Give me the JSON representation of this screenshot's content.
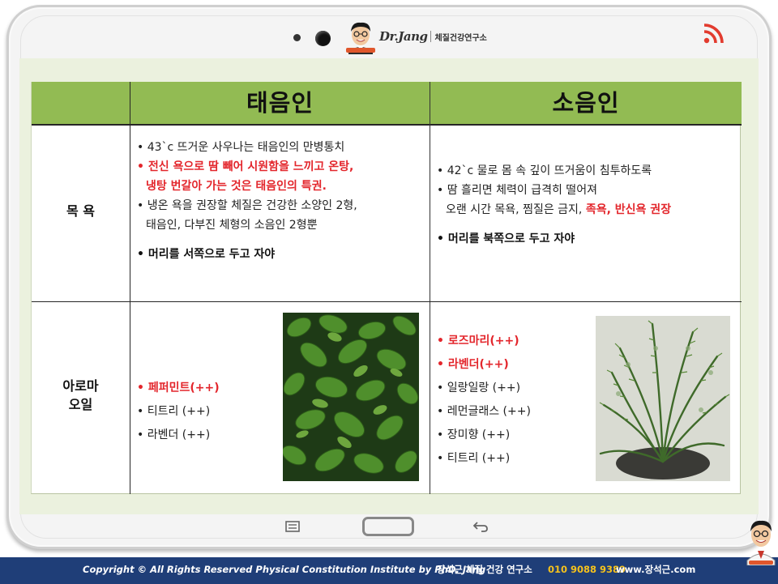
{
  "header": {
    "logo_brand": "Dr.Jang",
    "logo_tagline": "체질건강연구소"
  },
  "table": {
    "columns": [
      "태음인",
      "소음인"
    ],
    "rows": {
      "bath": {
        "label": "목  욕",
        "taeeum": [
          "• 43`c 뜨거운 사우나는 태음인의 만병통치",
          "• 전신 욕으로 땀 빼어 시원함을 느끼고 온탕,",
          "냉탕 번갈아 가는 것은 태음인의 특권.",
          "• 냉온 욕을 권장할 체질은 건강한 소양인 2형,",
          "태음인, 다부진 체형의 소음인 2형뿐",
          "• 머리를 서쪽으로 두고 자야"
        ],
        "soeum": [
          "• 42`c 물로 몸 속 깊이 뜨거움이 침투하도록",
          "• 땀 흘리면 체력이 급격히 떨어져",
          "오랜 시간 목욕, 찜질은 금지,",
          "족욕, 반신욕 권장",
          "• 머리를 북쪽으로 두고 자야"
        ]
      },
      "aroma": {
        "label_line1": "아로마",
        "label_line2": "오일",
        "taeeum": [
          "• 페퍼민트(++)",
          "• 티트리 (++)",
          "• 라벤더 (++)"
        ],
        "soeum": [
          "• 로즈마리(++)",
          "• 라벤더(++)",
          "• 일랑일랑 (++)",
          "• 레먼글래스 (++)",
          "• 장미향 (++)",
          "• 티트리 (++)"
        ],
        "photos": [
          "peppermint-photo",
          "rosemary-photo"
        ]
      }
    }
  },
  "footer": {
    "copyright": "Copyright © All Rights Reserved  Physical Constitution Institute  by  PhD. Jang",
    "institute": "장석근 체질 건강 연구소",
    "phone": "010 9088 9389",
    "website": "www.장석근.com"
  },
  "colors": {
    "header_green": "#92bb53",
    "screen_bg": "#ebf1de",
    "highlight_red": "#e3262c",
    "footer_navy": "#1f3e78",
    "phone_yellow": "#f6c21c"
  },
  "icons": [
    "signal-icon",
    "menu-icon",
    "home-button",
    "back-icon"
  ]
}
